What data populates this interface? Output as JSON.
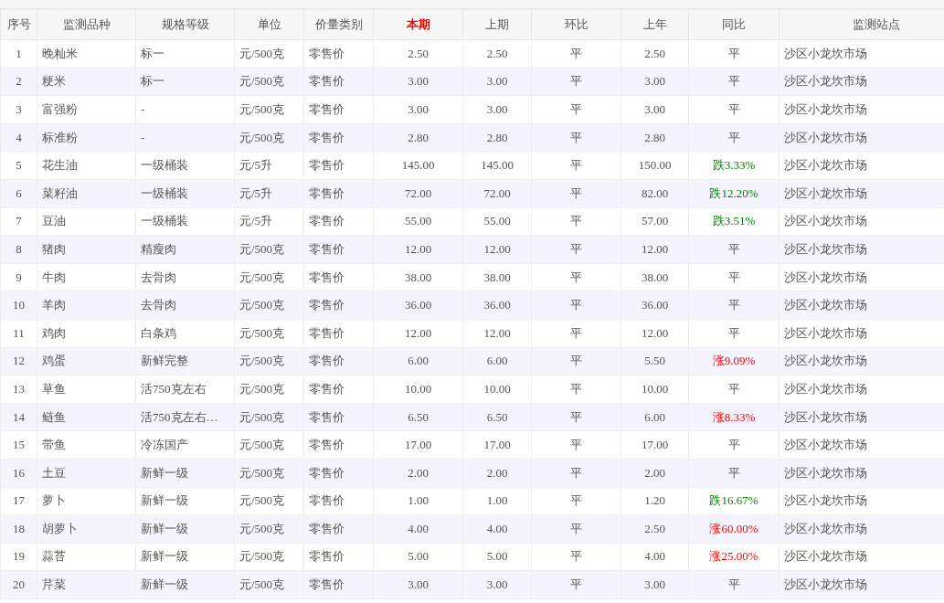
{
  "table": {
    "columns": [
      {
        "label": "序号",
        "highlighted": false
      },
      {
        "label": "监测品种",
        "highlighted": false
      },
      {
        "label": "规格等级",
        "highlighted": false
      },
      {
        "label": "单位",
        "highlighted": false
      },
      {
        "label": "价量类别",
        "highlighted": false
      },
      {
        "label": "本期",
        "highlighted": true
      },
      {
        "label": "上期",
        "highlighted": false
      },
      {
        "label": "环比",
        "highlighted": false
      },
      {
        "label": "上年",
        "highlighted": false
      },
      {
        "label": "同比",
        "highlighted": false
      },
      {
        "label": "监测站点",
        "highlighted": false
      }
    ],
    "rows": [
      {
        "no": "1",
        "item": "晚籼米",
        "grade": "标一",
        "unit": "元/500克",
        "type": "零售价",
        "current": "2.50",
        "previous": "2.50",
        "mom": "平",
        "last_year": "2.50",
        "yoy": {
          "text": "平",
          "kind": "flat"
        },
        "station": "沙区小龙坎市场"
      },
      {
        "no": "2",
        "item": "粳米",
        "grade": "标一",
        "unit": "元/500克",
        "type": "零售价",
        "current": "3.00",
        "previous": "3.00",
        "mom": "平",
        "last_year": "3.00",
        "yoy": {
          "text": "平",
          "kind": "flat"
        },
        "station": "沙区小龙坎市场"
      },
      {
        "no": "3",
        "item": "富强粉",
        "grade": "-",
        "unit": "元/500克",
        "type": "零售价",
        "current": "3.00",
        "previous": "3.00",
        "mom": "平",
        "last_year": "3.00",
        "yoy": {
          "text": "平",
          "kind": "flat"
        },
        "station": "沙区小龙坎市场"
      },
      {
        "no": "4",
        "item": "标准粉",
        "grade": "-",
        "unit": "元/500克",
        "type": "零售价",
        "current": "2.80",
        "previous": "2.80",
        "mom": "平",
        "last_year": "2.80",
        "yoy": {
          "text": "平",
          "kind": "flat"
        },
        "station": "沙区小龙坎市场"
      },
      {
        "no": "5",
        "item": "花生油",
        "grade": "一级桶装",
        "unit": "元/5升",
        "type": "零售价",
        "current": "145.00",
        "previous": "145.00",
        "mom": "平",
        "last_year": "150.00",
        "yoy": {
          "text": "跌3.33%",
          "kind": "down"
        },
        "station": "沙区小龙坎市场"
      },
      {
        "no": "6",
        "item": "菜籽油",
        "grade": "一级桶装",
        "unit": "元/5升",
        "type": "零售价",
        "current": "72.00",
        "previous": "72.00",
        "mom": "平",
        "last_year": "82.00",
        "yoy": {
          "text": "跌12.20%",
          "kind": "down"
        },
        "station": "沙区小龙坎市场"
      },
      {
        "no": "7",
        "item": "豆油",
        "grade": "一级桶装",
        "unit": "元/5升",
        "type": "零售价",
        "current": "55.00",
        "previous": "55.00",
        "mom": "平",
        "last_year": "57.00",
        "yoy": {
          "text": "跌3.51%",
          "kind": "down"
        },
        "station": "沙区小龙坎市场"
      },
      {
        "no": "8",
        "item": "猪肉",
        "grade": "精瘦肉",
        "unit": "元/500克",
        "type": "零售价",
        "current": "12.00",
        "previous": "12.00",
        "mom": "平",
        "last_year": "12.00",
        "yoy": {
          "text": "平",
          "kind": "flat"
        },
        "station": "沙区小龙坎市场"
      },
      {
        "no": "9",
        "item": "牛肉",
        "grade": "去骨肉",
        "unit": "元/500克",
        "type": "零售价",
        "current": "38.00",
        "previous": "38.00",
        "mom": "平",
        "last_year": "38.00",
        "yoy": {
          "text": "平",
          "kind": "flat"
        },
        "station": "沙区小龙坎市场"
      },
      {
        "no": "10",
        "item": "羊肉",
        "grade": "去骨肉",
        "unit": "元/500克",
        "type": "零售价",
        "current": "36.00",
        "previous": "36.00",
        "mom": "平",
        "last_year": "36.00",
        "yoy": {
          "text": "平",
          "kind": "flat"
        },
        "station": "沙区小龙坎市场"
      },
      {
        "no": "11",
        "item": "鸡肉",
        "grade": "白条鸡",
        "unit": "元/500克",
        "type": "零售价",
        "current": "12.00",
        "previous": "12.00",
        "mom": "平",
        "last_year": "12.00",
        "yoy": {
          "text": "平",
          "kind": "flat"
        },
        "station": "沙区小龙坎市场"
      },
      {
        "no": "12",
        "item": "鸡蛋",
        "grade": "新鲜完整",
        "unit": "元/500克",
        "type": "零售价",
        "current": "6.00",
        "previous": "6.00",
        "mom": "平",
        "last_year": "5.50",
        "yoy": {
          "text": "涨9.09%",
          "kind": "up"
        },
        "station": "沙区小龙坎市场"
      },
      {
        "no": "13",
        "item": "草鱼",
        "grade": "活750克左右",
        "unit": "元/500克",
        "type": "零售价",
        "current": "10.00",
        "previous": "10.00",
        "mom": "平",
        "last_year": "10.00",
        "yoy": {
          "text": "平",
          "kind": "flat"
        },
        "station": "沙区小龙坎市场"
      },
      {
        "no": "14",
        "item": "鲢鱼",
        "grade": "活750克左右…",
        "unit": "元/500克",
        "type": "零售价",
        "current": "6.50",
        "previous": "6.50",
        "mom": "平",
        "last_year": "6.00",
        "yoy": {
          "text": "涨8.33%",
          "kind": "up"
        },
        "station": "沙区小龙坎市场"
      },
      {
        "no": "15",
        "item": "带鱼",
        "grade": "冷冻国产",
        "unit": "元/500克",
        "type": "零售价",
        "current": "17.00",
        "previous": "17.00",
        "mom": "平",
        "last_year": "17.00",
        "yoy": {
          "text": "平",
          "kind": "flat"
        },
        "station": "沙区小龙坎市场"
      },
      {
        "no": "16",
        "item": "土豆",
        "grade": "新鲜一级",
        "unit": "元/500克",
        "type": "零售价",
        "current": "2.00",
        "previous": "2.00",
        "mom": "平",
        "last_year": "2.00",
        "yoy": {
          "text": "平",
          "kind": "flat"
        },
        "station": "沙区小龙坎市场"
      },
      {
        "no": "17",
        "item": "萝卜",
        "grade": "新鲜一级",
        "unit": "元/500克",
        "type": "零售价",
        "current": "1.00",
        "previous": "1.00",
        "mom": "平",
        "last_year": "1.20",
        "yoy": {
          "text": "跌16.67%",
          "kind": "down"
        },
        "station": "沙区小龙坎市场"
      },
      {
        "no": "18",
        "item": "胡萝卜",
        "grade": "新鲜一级",
        "unit": "元/500克",
        "type": "零售价",
        "current": "4.00",
        "previous": "4.00",
        "mom": "平",
        "last_year": "2.50",
        "yoy": {
          "text": "涨60.00%",
          "kind": "up"
        },
        "station": "沙区小龙坎市场"
      },
      {
        "no": "19",
        "item": "蒜苔",
        "grade": "新鲜一级",
        "unit": "元/500克",
        "type": "零售价",
        "current": "5.00",
        "previous": "5.00",
        "mom": "平",
        "last_year": "4.00",
        "yoy": {
          "text": "涨25.00%",
          "kind": "up"
        },
        "station": "沙区小龙坎市场"
      },
      {
        "no": "20",
        "item": "芹菜",
        "grade": "新鲜一级",
        "unit": "元/500克",
        "type": "零售价",
        "current": "3.00",
        "previous": "3.00",
        "mom": "平",
        "last_year": "3.00",
        "yoy": {
          "text": "平",
          "kind": "flat"
        },
        "station": "沙区小龙坎市场"
      }
    ]
  }
}
